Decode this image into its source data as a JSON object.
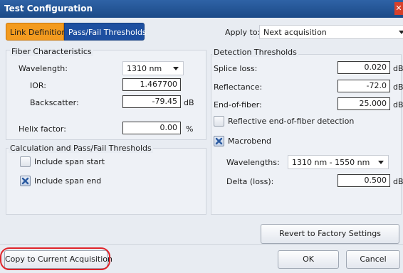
{
  "window": {
    "title": "Test Configuration"
  },
  "tabs": [
    {
      "label": "Link Definition",
      "active": true
    },
    {
      "label": "Pass/Fail Thresholds",
      "active": false
    }
  ],
  "apply_to": {
    "label": "Apply to:",
    "value": "Next acquisition"
  },
  "fiber": {
    "title": "Fiber Characteristics",
    "wavelength_label": "Wavelength:",
    "wavelength_value": "1310 nm",
    "ior_label": "IOR:",
    "ior_value": "1.467700",
    "backscatter_label": "Backscatter:",
    "backscatter_value": "-79.45",
    "backscatter_unit": "dB",
    "helix_label": "Helix factor:",
    "helix_value": "0.00",
    "helix_unit": "%"
  },
  "calc": {
    "title": "Calculation and Pass/Fail Thresholds",
    "include_span_start": {
      "label": "Include span start",
      "checked": false
    },
    "include_span_end": {
      "label": "Include span end",
      "checked": true
    }
  },
  "detection": {
    "title": "Detection Thresholds",
    "splice_label": "Splice loss:",
    "splice_value": "0.020",
    "splice_unit": "dB",
    "reflectance_label": "Reflectance:",
    "reflectance_value": "-72.0",
    "reflectance_unit": "dB",
    "eof_label": "End-of-fiber:",
    "eof_value": "25.000",
    "eof_unit": "dB",
    "reflective_eof": {
      "label": "Reflective end-of-fiber detection",
      "checked": false
    },
    "macrobend": {
      "label": "Macrobend",
      "checked": true
    },
    "wavelengths_label": "Wavelengths:",
    "wavelengths_value": "1310 nm - 1550 nm",
    "delta_label": "Delta (loss):",
    "delta_value": "0.500",
    "delta_unit": "dB"
  },
  "buttons": {
    "revert": "Revert to Factory Settings",
    "copy": "Copy to Current Acquisition",
    "ok": "OK",
    "cancel": "Cancel"
  },
  "colors": {
    "title_bar": "#1b4a87",
    "tab_active": "#f39b1f",
    "tab_inactive": "#1d4fa0",
    "highlight_ring": "#e0242a"
  }
}
